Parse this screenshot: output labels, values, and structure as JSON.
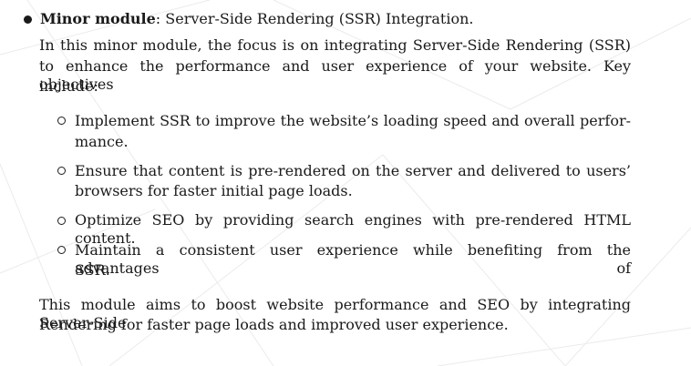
{
  "section": {
    "title_bold": "Minor module",
    "title_rest": ": Server-Side Rendering (SSR) Integration."
  },
  "intro": {
    "line1": "In this minor module, the focus is on integrating Server-Side Rendering (SSR)",
    "line2": "to enhance the performance and user experience of your website. Key objectives",
    "line3": "include:"
  },
  "objectives": [
    {
      "line1": "Implement SSR to improve the website’s loading speed and overall perfor-",
      "line2": "mance."
    },
    {
      "line1": "Ensure that content is pre-rendered on the server and delivered to users’",
      "line2": "browsers for faster initial page loads."
    },
    {
      "line1": "Optimize SEO by providing search engines with pre-rendered HTML content."
    },
    {
      "line1": "Maintain a consistent user experience while benefiting from the advantages of",
      "line2": "SSR."
    }
  ],
  "summary": {
    "line1": "This module aims to boost website performance and SEO by integrating Server-Side",
    "line2": "Rendering for faster page loads and improved user experience."
  }
}
